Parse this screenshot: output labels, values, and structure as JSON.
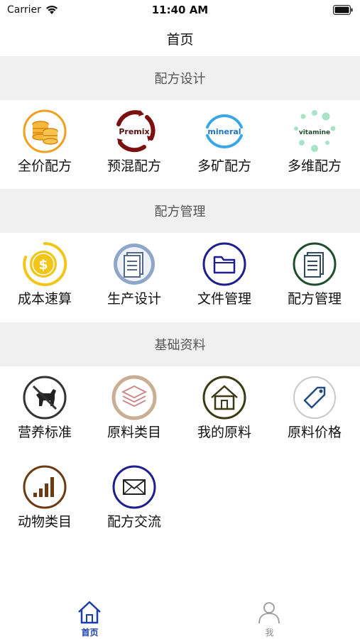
{
  "status_bar": {
    "carrier": "Carrier",
    "time": "11:40 AM"
  },
  "nav": {
    "title": "首页"
  },
  "sections": [
    {
      "title": "配方设计",
      "items": [
        {
          "label": "全价配方",
          "icon": "coins-icon",
          "icon_text": ""
        },
        {
          "label": "预混配方",
          "icon": "premix-icon",
          "icon_text": "Premix"
        },
        {
          "label": "多矿配方",
          "icon": "mineral-icon",
          "icon_text": "mineral"
        },
        {
          "label": "多维配方",
          "icon": "vitamine-icon",
          "icon_text": "vitamine"
        }
      ]
    },
    {
      "title": "配方管理",
      "items": [
        {
          "label": "成本速算",
          "icon": "dollar-coin-icon"
        },
        {
          "label": "生产设计",
          "icon": "document-list-icon"
        },
        {
          "label": "文件管理",
          "icon": "folder-icon"
        },
        {
          "label": "配方管理",
          "icon": "list-doc-icon"
        }
      ]
    },
    {
      "title": "基础资料",
      "items": [
        {
          "label": "营养标准",
          "icon": "dog-icon"
        },
        {
          "label": "原料类目",
          "icon": "layers-icon"
        },
        {
          "label": "我的原料",
          "icon": "house-icon"
        },
        {
          "label": "原料价格",
          "icon": "price-tag-icon"
        },
        {
          "label": "动物类目",
          "icon": "bar-signal-icon"
        },
        {
          "label": "配方交流",
          "icon": "envelope-icon"
        }
      ]
    }
  ],
  "tab_bar": {
    "tabs": [
      {
        "label": "首页",
        "icon": "home-icon",
        "active": true
      },
      {
        "label": "我",
        "icon": "person-icon",
        "active": false
      }
    ]
  },
  "colors": {
    "accent": "#1a3faa",
    "section_bg": "#f0f0f0"
  }
}
